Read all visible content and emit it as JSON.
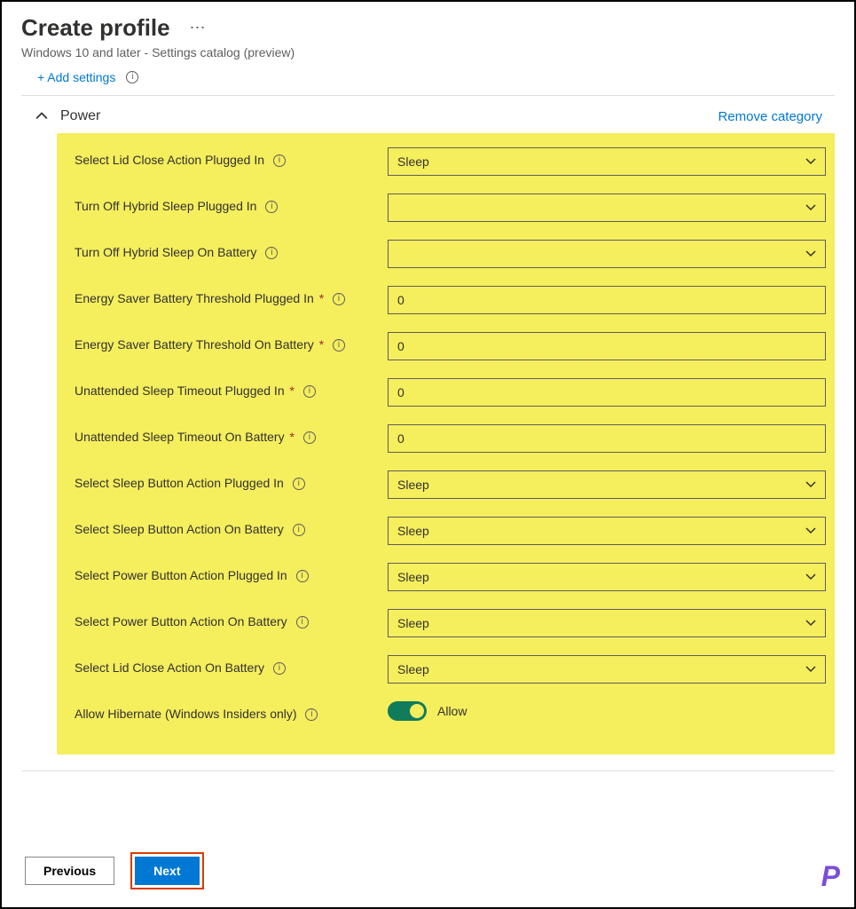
{
  "header": {
    "title": "Create profile",
    "subtitle": "Windows 10 and later - Settings catalog (preview)",
    "add_settings_label": "+ Add settings"
  },
  "category": {
    "title": "Power",
    "remove_label": "Remove category"
  },
  "settings": [
    {
      "label": "Select Lid Close Action Plugged In",
      "required": false,
      "type": "select",
      "value": "Sleep"
    },
    {
      "label": "Turn Off Hybrid Sleep Plugged In",
      "required": false,
      "type": "select",
      "value": ""
    },
    {
      "label": "Turn Off Hybrid Sleep On Battery",
      "required": false,
      "type": "select",
      "value": ""
    },
    {
      "label": "Energy Saver Battery Threshold Plugged In",
      "required": true,
      "type": "input",
      "value": "0"
    },
    {
      "label": "Energy Saver Battery Threshold On Battery",
      "required": true,
      "type": "input",
      "value": "0"
    },
    {
      "label": "Unattended Sleep Timeout Plugged In",
      "required": true,
      "type": "input",
      "value": "0"
    },
    {
      "label": "Unattended Sleep Timeout On Battery",
      "required": true,
      "type": "input",
      "value": "0"
    },
    {
      "label": "Select Sleep Button Action Plugged In",
      "required": false,
      "type": "select",
      "value": "Sleep"
    },
    {
      "label": "Select Sleep Button Action On Battery",
      "required": false,
      "type": "select",
      "value": "Sleep"
    },
    {
      "label": "Select Power Button Action Plugged In",
      "required": false,
      "type": "select",
      "value": "Sleep"
    },
    {
      "label": "Select Power Button Action On Battery",
      "required": false,
      "type": "select",
      "value": "Sleep"
    },
    {
      "label": "Select Lid Close Action On Battery",
      "required": false,
      "type": "select",
      "value": "Sleep"
    },
    {
      "label": "Allow Hibernate (Windows Insiders only)",
      "required": false,
      "type": "toggle",
      "value": "Allow",
      "on": true
    }
  ],
  "footer": {
    "previous": "Previous",
    "next": "Next"
  },
  "watermark": "P"
}
